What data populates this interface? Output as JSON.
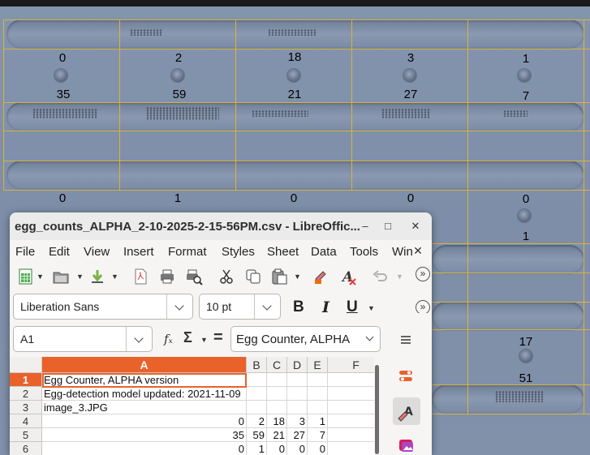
{
  "background": {
    "row1_counts": [
      "0",
      "2",
      "18",
      "3",
      "1"
    ],
    "row2_counts": [
      "35",
      "59",
      "21",
      "27",
      "7"
    ],
    "row3_counts": [
      "0",
      "1",
      "0",
      "0",
      "0"
    ],
    "side_counts": [
      "1",
      "17",
      "51"
    ]
  },
  "window": {
    "title": "egg_counts_ALPHA_2-10-2025-2-15-56PM.csv - LibreOffic...",
    "minimize": "–",
    "maximize": "□",
    "close": "✕"
  },
  "menu": {
    "items": [
      "File",
      "Edit",
      "View",
      "Insert",
      "Format",
      "Styles",
      "Sheet",
      "Data",
      "Tools",
      "Win"
    ],
    "close": "✕"
  },
  "toolbar": {
    "more": "»",
    "font_name": "Liberation Sans",
    "font_size": "10 pt",
    "bold": "B",
    "italic": "I",
    "underline": "U"
  },
  "formula_bar": {
    "name_box": "A1",
    "fx": "fₓ",
    "sigma": "Σ",
    "equals": "=",
    "content": "Egg Counter, ALPHA"
  },
  "sheet": {
    "columns": [
      "A",
      "B",
      "C",
      "D",
      "E",
      "F"
    ],
    "rows": [
      {
        "n": "1",
        "cells": [
          "Egg Counter, ALPHA version",
          "",
          "",
          "",
          "",
          ""
        ]
      },
      {
        "n": "2",
        "cells": [
          "Egg-detection model updated: 2021-11-09",
          "",
          "",
          "",
          "",
          ""
        ]
      },
      {
        "n": "3",
        "cells": [
          "image_3.JPG",
          "",
          "",
          "",
          "",
          ""
        ]
      },
      {
        "n": "4",
        "cells": [
          "0",
          "2",
          "18",
          "3",
          "1",
          ""
        ]
      },
      {
        "n": "5",
        "cells": [
          "35",
          "59",
          "21",
          "27",
          "7",
          ""
        ]
      },
      {
        "n": "6",
        "cells": [
          "0",
          "1",
          "0",
          "0",
          "0",
          ""
        ]
      }
    ]
  },
  "colors": {
    "accent": "#e9622a",
    "grid_lines": "#d9b33c"
  }
}
